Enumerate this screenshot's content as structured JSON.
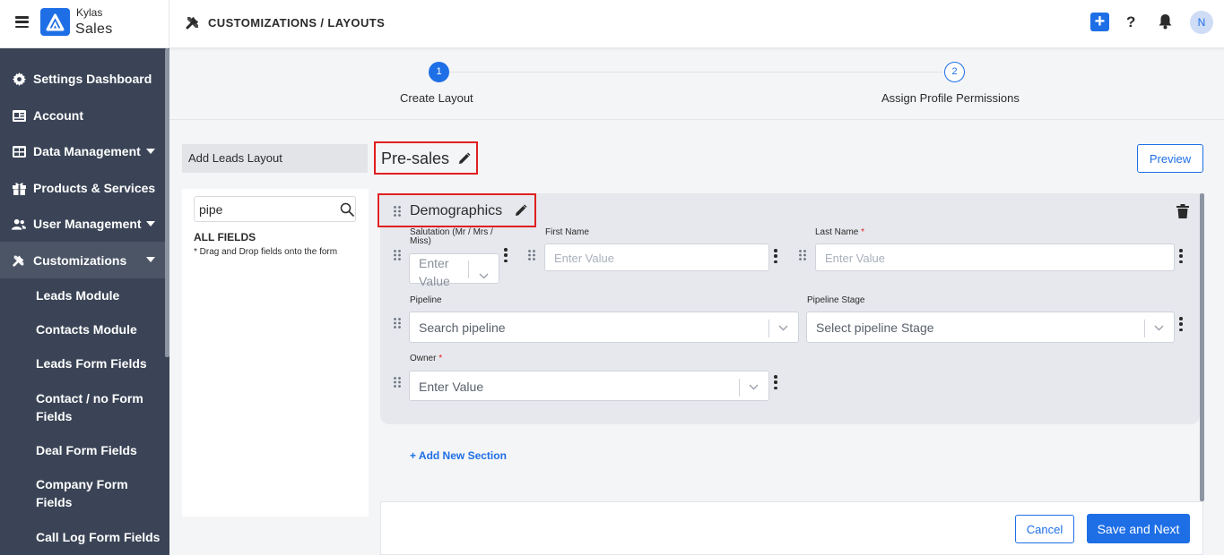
{
  "app": {
    "brand_small": "Kylas",
    "brand_big": "Sales",
    "avatar_initial": "N",
    "help_glyph": "?",
    "plus_glyph": "+"
  },
  "header": {
    "breadcrumb": "CUSTOMIZATIONS / LAYOUTS"
  },
  "sidebar": {
    "items": [
      {
        "label": "Settings Dashboard",
        "icon": "gear-icon"
      },
      {
        "label": "Account",
        "icon": "id-card-icon"
      },
      {
        "label": "Data Management",
        "icon": "table-icon"
      },
      {
        "label": "Products & Services",
        "icon": "gift-icon"
      },
      {
        "label": "User Management",
        "icon": "users-icon"
      },
      {
        "label": "Customizations",
        "icon": "tools-icon"
      }
    ],
    "sub_items": [
      "Leads Module",
      "Contacts Module",
      "Leads Form Fields",
      "Contact / no Form Fields",
      "Deal Form Fields",
      "Company Form Fields",
      "Call Log Form Fields"
    ]
  },
  "stepper": {
    "steps": [
      {
        "number": "1",
        "label": "Create Layout"
      },
      {
        "number": "2",
        "label": "Assign Profile Permissions"
      }
    ]
  },
  "left_panel": {
    "tab_label": "Add Leads Layout",
    "search_value": "pipe",
    "all_fields_label": "ALL FIELDS",
    "hint": "* Drag and Drop fields onto the form"
  },
  "layout": {
    "name": "Pre-sales",
    "preview_label": "Preview"
  },
  "section": {
    "title": "Demographics",
    "fields": {
      "salutation": {
        "label": "Salutation (Mr / Mrs / Miss)",
        "placeholder": "Enter Value"
      },
      "first_name": {
        "label": "First Name",
        "placeholder": "Enter Value"
      },
      "last_name": {
        "label": "Last Name",
        "required": "*",
        "placeholder": "Enter Value"
      },
      "pipeline": {
        "label": "Pipeline",
        "placeholder": "Search pipeline"
      },
      "pipeline_stage": {
        "label": "Pipeline Stage",
        "placeholder": "Select pipeline Stage"
      },
      "owner": {
        "label": "Owner",
        "required": "*",
        "placeholder": "Enter Value"
      }
    }
  },
  "add_section_label": "+ Add New Section",
  "footer": {
    "cancel_label": "Cancel",
    "save_label": "Save and Next"
  },
  "colors": {
    "accent": "#1e6fe6",
    "sidebar": "#3a4456",
    "highlight": "#e02020"
  }
}
